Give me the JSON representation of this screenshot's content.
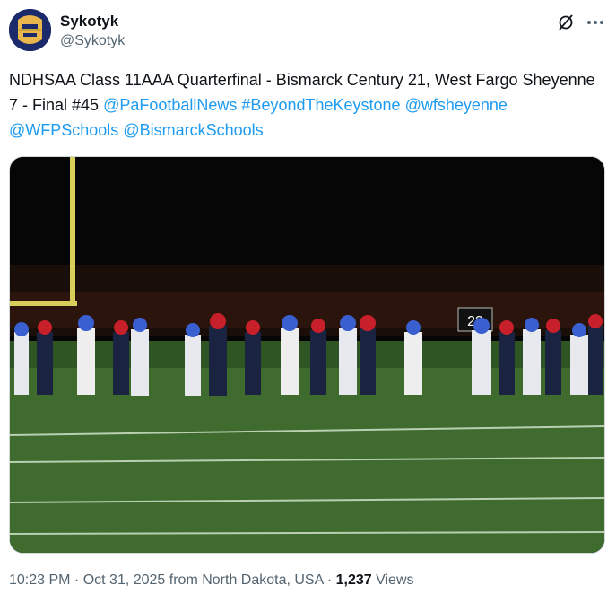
{
  "author": {
    "display_name": "Sykotyk",
    "handle": "@Sykotyk",
    "avatar_icon": "avatar-mascot-icon"
  },
  "tweet": {
    "text_plain": "NDHSAA Class 11AAA Quarterfinal - Bismarck Century 21, West Fargo Sheyenne 7 - Final #45 ",
    "mentions": [
      "@PaFootballNews",
      "#BeyondTheKeystone",
      "@wfsheyenne",
      "@WFPSchools",
      "@BismarckSchools"
    ]
  },
  "media": {
    "scoreboard_text": "23"
  },
  "meta": {
    "time": "10:23 PM",
    "sep1": " · ",
    "date": "Oct 31, 2025",
    "location": " from North Dakota, USA",
    "sep2": " · ",
    "views_count": "1,237",
    "views_label": " Views"
  },
  "colors": {
    "link": "#1d9bf0",
    "text": "#0f1419",
    "muted": "#536471"
  }
}
